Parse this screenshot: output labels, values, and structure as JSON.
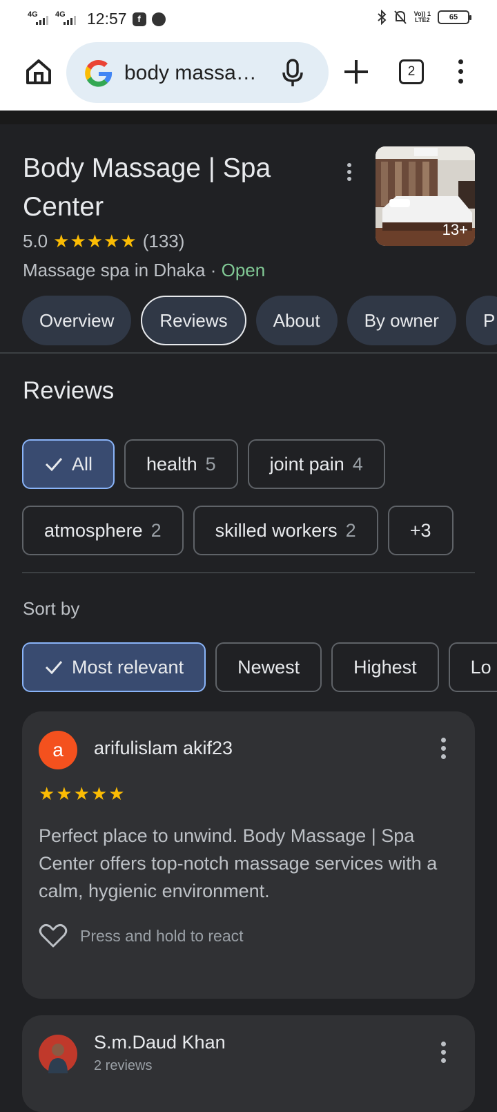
{
  "status_bar": {
    "net1": "4G",
    "net2": "4G",
    "time": "12:57",
    "volte_line1": "Vo)) 1",
    "volte_line2": "LTE2",
    "battery": "65"
  },
  "browser": {
    "omnibox_text": "body massa…",
    "tab_count": "2"
  },
  "place": {
    "title": "Body Massage | Spa Center",
    "rating": "5.0",
    "stars": "★★★★★",
    "review_count": "(133)",
    "type": "Massage spa in Dhaka · ",
    "status": "Open",
    "photo_count": "13+"
  },
  "tabs": [
    {
      "label": "Overview"
    },
    {
      "label": "Reviews",
      "active": true
    },
    {
      "label": "About"
    },
    {
      "label": "By owner"
    },
    {
      "label": "P"
    }
  ],
  "reviews_section": {
    "heading": "Reviews",
    "topic_chips_row1": [
      {
        "label": "All",
        "count": "",
        "selected": true
      },
      {
        "label": "health",
        "count": "5"
      },
      {
        "label": "joint pain",
        "count": "4"
      }
    ],
    "topic_chips_row2": [
      {
        "label": "atmosphere",
        "count": "2"
      },
      {
        "label": "skilled workers",
        "count": "2"
      },
      {
        "label": "+3",
        "count": ""
      }
    ],
    "sort_label": "Sort by",
    "sort_chips": [
      {
        "label": "Most relevant",
        "selected": true
      },
      {
        "label": "Newest"
      },
      {
        "label": "Highest"
      },
      {
        "label": "Lo"
      }
    ]
  },
  "reviews": [
    {
      "avatar_letter": "a",
      "name": "arifulislam akif23",
      "stars": "★★★★★",
      "text": "Perfect place to unwind. Body Massage | Spa Center offers top-notch massage services with a calm, hygienic environment.",
      "react_hint": "Press and hold to react"
    },
    {
      "name": "S.m.Daud Khan",
      "meta": "2 reviews"
    }
  ],
  "colors": {
    "accent_star": "#fbbc04",
    "open_green": "#81c995",
    "selected_chip_bg": "#394b70",
    "avatar_orange": "#f4511e"
  }
}
